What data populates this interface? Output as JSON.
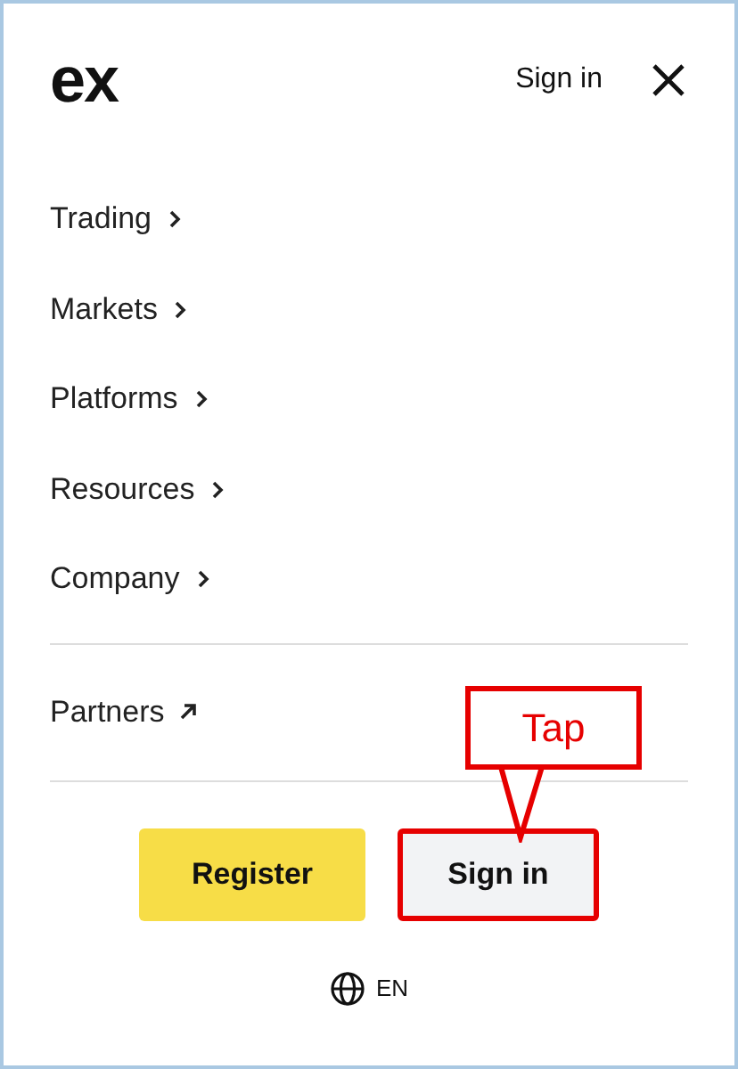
{
  "header": {
    "logo": "ex",
    "sign_in": "Sign in"
  },
  "menu": [
    {
      "label": "Trading",
      "kind": "chevron"
    },
    {
      "label": "Markets",
      "kind": "chevron"
    },
    {
      "label": "Platforms",
      "kind": "chevron"
    },
    {
      "label": "Resources",
      "kind": "chevron"
    },
    {
      "label": "Company",
      "kind": "chevron"
    }
  ],
  "partners": {
    "label": "Partners",
    "kind": "external"
  },
  "buttons": [
    {
      "label": "Register",
      "kind": "primary",
      "highlighted": false
    },
    {
      "label": "Sign in",
      "kind": "secondary",
      "highlighted": true
    }
  ],
  "callout": {
    "text": "Tap"
  },
  "language": "EN"
}
